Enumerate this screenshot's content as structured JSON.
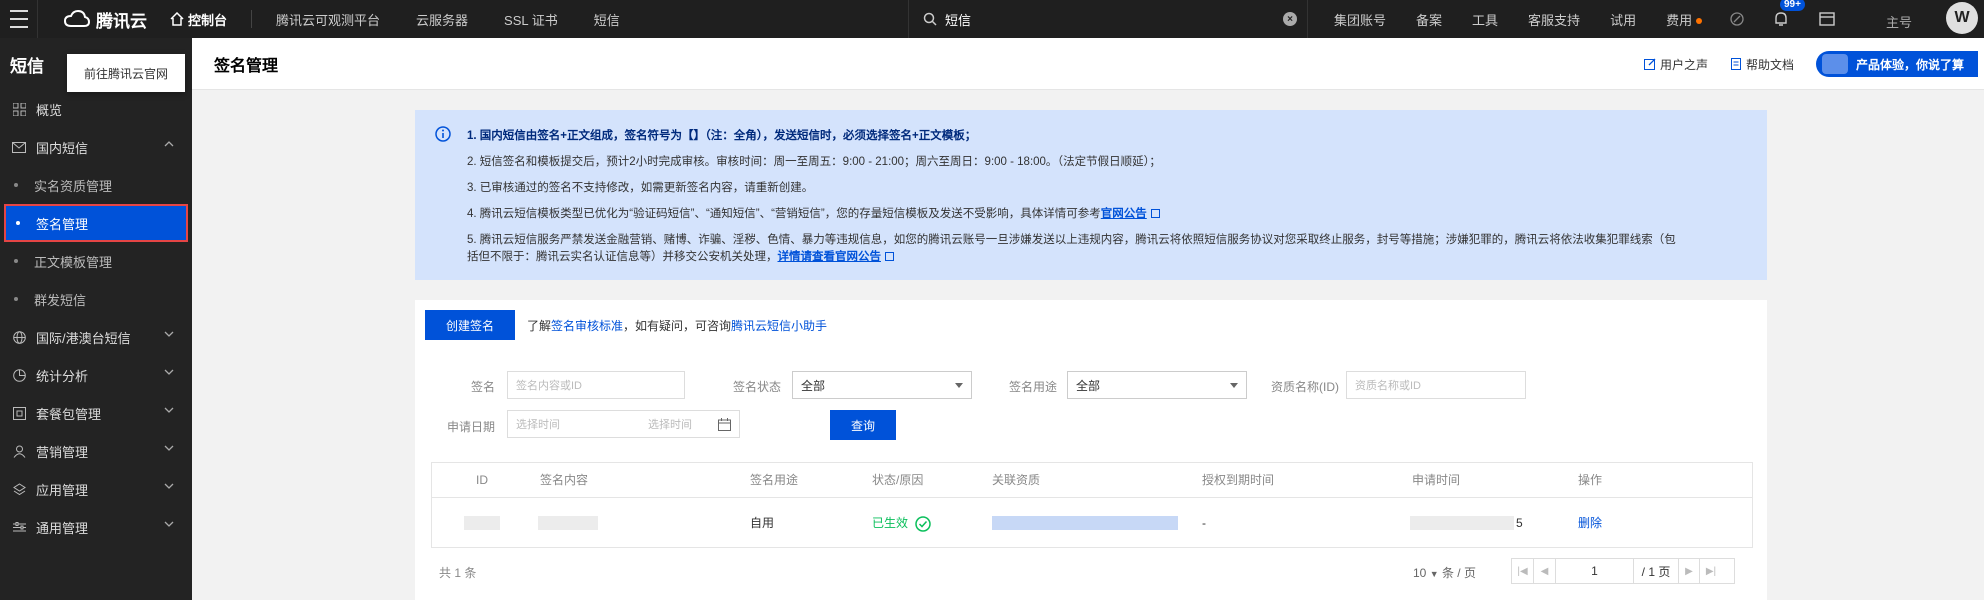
{
  "topbar": {
    "brand": "腾讯云",
    "console": "控制台",
    "links": [
      "腾讯云可观测平台",
      "云服务器",
      "SSL 证书",
      "短信"
    ],
    "search_value": "短信",
    "right_links": [
      "集团账号",
      "备案",
      "工具",
      "客服支持",
      "试用",
      "费用"
    ],
    "notification_count": "99+",
    "account": "主号",
    "avatar_letter": "W"
  },
  "sidebar": {
    "title": "短信",
    "tooltip": "前往腾讯云官网",
    "items": [
      {
        "label": "概览",
        "icon": "grid-icon"
      },
      {
        "label": "国内短信",
        "icon": "mail-icon",
        "expanded": true
      },
      {
        "label": "实名资质管理"
      },
      {
        "label": "签名管理",
        "active": true
      },
      {
        "label": "正文模板管理"
      },
      {
        "label": "群发短信"
      },
      {
        "label": "国际/港澳台短信",
        "icon": "globe-icon"
      },
      {
        "label": "统计分析",
        "icon": "chart-icon"
      },
      {
        "label": "套餐包管理",
        "icon": "package-icon"
      },
      {
        "label": "营销管理",
        "icon": "user-icon"
      },
      {
        "label": "应用管理",
        "icon": "layers-icon"
      },
      {
        "label": "通用管理",
        "icon": "settings-icon"
      }
    ]
  },
  "header": {
    "title": "签名管理",
    "user_guide": "用户之声",
    "help_doc": "帮助文档",
    "promo": "产品体验，你说了算"
  },
  "notice": {
    "line1": "1. 国内短信由签名+正文组成，签名符号为【】（注：全角），发送短信时，必须选择签名+正文模板；",
    "line2": "2. 短信签名和模板提交后，预计2小时完成审核。审核时间：周一至周五：9:00 - 21:00；周六至周日：9:00 - 18:00。（法定节假日顺延）；",
    "line3": "3. 已审核通过的签名不支持修改，如需更新签名内容，请重新创建。",
    "line4_text": "4. 腾讯云短信模板类型已优化为“验证码短信”、“通知短信”、“营销短信”，您的存量短信模板及发送不受影响，具体详情可参考",
    "line4_link": "官网公告",
    "line5_text": "5. 腾讯云短信服务严禁发送金融营销、赌博、诈骗、淫秽、色情、暴力等违规信息，如您的腾讯云账号一旦涉嫌发送以上违规内容，腾讯云将依照短信服务协议对您采取终止服务，封号等措施；涉嫌犯罪的，腾讯云将依法收集犯罪线索（包",
    "line5b_text": "括但不限于：腾讯云实名认证信息等）并移交公安机关处理，",
    "line5_link": "详情请查看官网公告"
  },
  "toolbar": {
    "create_button": "创建签名",
    "tip_prefix": "了解",
    "tip_link1": "签名审核标准",
    "tip_middle": "，如有疑问，可咨询",
    "tip_link2": "腾讯云短信小助手"
  },
  "filters": {
    "sign_label": "签名",
    "sign_placeholder": "签名内容或ID",
    "status_label": "签名状态",
    "status_value": "全部",
    "usage_label": "签名用途",
    "usage_value": "全部",
    "qual_label": "资质名称(ID)",
    "qual_placeholder": "资质名称或ID",
    "date_label": "申请日期",
    "date_start_placeholder": "选择时间",
    "date_end_placeholder": "选择时间",
    "query_button": "查询"
  },
  "table": {
    "columns": [
      "ID",
      "签名内容",
      "签名用途",
      "状态/原因",
      "关联资质",
      "授权到期时间",
      "申请时间",
      "操作"
    ],
    "rows": [
      {
        "usage": "自用",
        "status": "已生效",
        "expiry": "-",
        "time_suffix": "5",
        "action": "删除"
      }
    ]
  },
  "pagination": {
    "total": "共 1 条",
    "page_size": "10",
    "page_size_suffix": "条 / 页",
    "current_page": "1",
    "total_pages": "/ 1 页"
  },
  "colors": {
    "primary": "#0052d9",
    "success": "#0abf5b",
    "notice_bg": "#d4e3fc",
    "sidebar_bg": "#232323",
    "topbar_bg": "#1f1f1f"
  }
}
